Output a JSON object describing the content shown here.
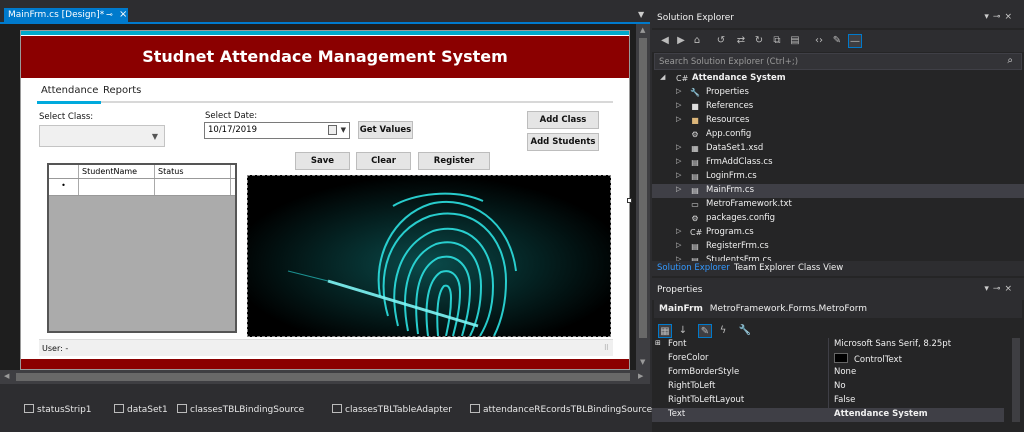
{
  "doc_tab": {
    "title": "MainFrm.cs [Design]*",
    "pin": "⊸",
    "close": "×"
  },
  "form": {
    "header": "Studnet Attendace Management System",
    "tabs": [
      "Attendance",
      "Reports"
    ],
    "select_class_label": "Select Class:",
    "select_date_label": "Select Date:",
    "date_value": "10/17/2019",
    "buttons": {
      "get_values": "Get Values",
      "add_class": "Add Class",
      "add_students": "Add Students",
      "save": "Save",
      "clear": "Clear",
      "register": "Register"
    },
    "grid": {
      "columns": [
        "StudentName",
        "Status"
      ],
      "new_row_marker": "•"
    },
    "status": "User:  -"
  },
  "tray": [
    "statusStrip1",
    "dataSet1",
    "classesTBLBindingSource",
    "classesTBLTableAdapter",
    "attendanceREcordsTBLBindingSource"
  ],
  "solution_explorer": {
    "title": "Solution Explorer",
    "search_placeholder": "Search Solution Explorer (Ctrl+;)",
    "root": "Attendance System",
    "items": [
      {
        "label": "Properties",
        "icon": "wrench-icon",
        "expandable": true
      },
      {
        "label": "References",
        "icon": "references-icon",
        "expandable": true
      },
      {
        "label": "Resources",
        "icon": "folder-icon",
        "expandable": true
      },
      {
        "label": "App.config",
        "icon": "config-icon",
        "expandable": false
      },
      {
        "label": "DataSet1.xsd",
        "icon": "dataset-icon",
        "expandable": true
      },
      {
        "label": "FrmAddClass.cs",
        "icon": "form-icon",
        "expandable": true
      },
      {
        "label": "LoginFrm.cs",
        "icon": "form-icon",
        "expandable": true
      },
      {
        "label": "MainFrm.cs",
        "icon": "form-icon",
        "expandable": true,
        "selected": true
      },
      {
        "label": "MetroFramework.txt",
        "icon": "text-file-icon",
        "expandable": false
      },
      {
        "label": "packages.config",
        "icon": "config-icon",
        "expandable": false
      },
      {
        "label": "Program.cs",
        "icon": "csharp-icon",
        "expandable": true
      },
      {
        "label": "RegisterFrm.cs",
        "icon": "form-icon",
        "expandable": true
      },
      {
        "label": "StudentsFrm.cs",
        "icon": "form-icon",
        "expandable": true
      }
    ],
    "tabs": [
      "Solution Explorer",
      "Team Explorer",
      "Class View"
    ]
  },
  "properties": {
    "title": "Properties",
    "object_name": "MainFrm",
    "object_type": "MetroFramework.Forms.MetroForm",
    "rows": [
      {
        "name": "Font",
        "value": "Microsoft Sans Serif, 8.25pt",
        "expandable": true
      },
      {
        "name": "ForeColor",
        "value": "ControlText",
        "swatch": "#000000"
      },
      {
        "name": "FormBorderStyle",
        "value": "None"
      },
      {
        "name": "RightToLeft",
        "value": "No"
      },
      {
        "name": "RightToLeftLayout",
        "value": "False"
      },
      {
        "name": "Text",
        "value": "Attendance System",
        "bold": true,
        "selected": true
      }
    ]
  },
  "colors": {
    "accent": "#007acc",
    "header_red": "#8b0000",
    "fingerprint": "#2de0e0"
  }
}
